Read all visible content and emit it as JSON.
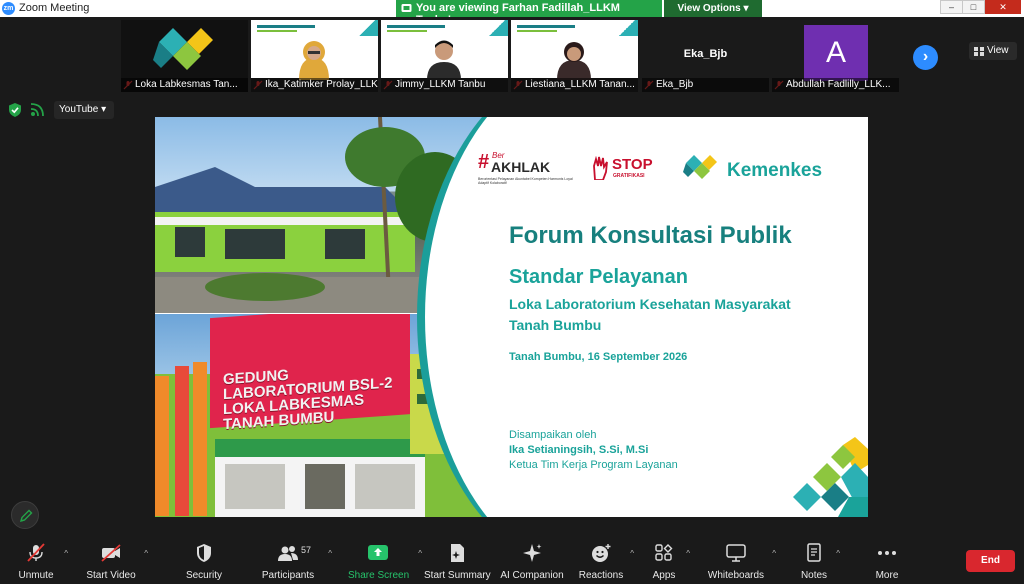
{
  "window": {
    "title": "Zoom Meeting",
    "controls": [
      "–",
      "□",
      "✕"
    ]
  },
  "share_banner": {
    "text": "You are viewing Farhan Fadillah_LLKM Tanbu's screen",
    "view_options": "View Options"
  },
  "gallery": {
    "tiles": [
      {
        "name": "Loka Labkesmas Tan...",
        "muted": true
      },
      {
        "name": "Ika_Katimker Prolay_LLK...",
        "muted": true
      },
      {
        "name": "Jimmy_LLKM Tanbu",
        "muted": true
      },
      {
        "name": "Liestiana_LLKM Tanan...",
        "muted": true
      },
      {
        "name": "Eka_Bjb",
        "label": "Eka_Bjb",
        "muted": true
      },
      {
        "name": "Abdullah Fadlilly_LLK...",
        "avatar_letter": "A",
        "muted": true
      }
    ],
    "view_label": "View",
    "thumb_title": "FORUM KONSULTASI PUBLIK"
  },
  "toolbar_secondary": {
    "youtube_label": "YouTube"
  },
  "slide": {
    "title": "Forum Konsultasi Publik",
    "subtitle": "Standar Pelayanan",
    "lab_line1": "Loka Laboratorium Kesehatan Masyarakat",
    "lab_line2": "Tanah Bumbu",
    "date": "Tanah Bumbu, 16 September 2026",
    "presented_by": "Disampaikan oleh",
    "presenter": "Ika Setianingsih, S.Si, M.Si",
    "presenter_role": "Ketua Tim Kerja Program Layanan",
    "logo_kemenkes": "Kemenkes",
    "logo_akhlak_ber": "Ber",
    "logo_akhlak": "#AKHLAK",
    "logo_akhlak_tagline": "Berorientasi Pelayanan Akuntabel Kompeten Harmonis Loyal Adaptif Kolaboratif",
    "logo_stop": "STOP",
    "logo_gratifikasi": "GRATIFIKASI",
    "building_sign_1": "GEDUNG",
    "building_sign_2": "LABORATORIUM BSL-2",
    "building_sign_3": "LOKA LABKESMAS",
    "building_sign_4": "TANAH BUMBU"
  },
  "toolbar": {
    "unmute": "Unmute",
    "start_video": "Start Video",
    "security": "Security",
    "participants": "Participants",
    "participants_count": "57",
    "share_screen": "Share Screen",
    "start_summary": "Start Summary",
    "ai_companion": "AI Companion",
    "reactions": "Reactions",
    "apps": "Apps",
    "whiteboards": "Whiteboards",
    "notes": "Notes",
    "more": "More",
    "end": "End"
  },
  "colors": {
    "kemenkes_teal": "#1aa39a",
    "share_green": "#24a348",
    "end_red": "#d9272e",
    "zoom_blue": "#2d8cff"
  }
}
